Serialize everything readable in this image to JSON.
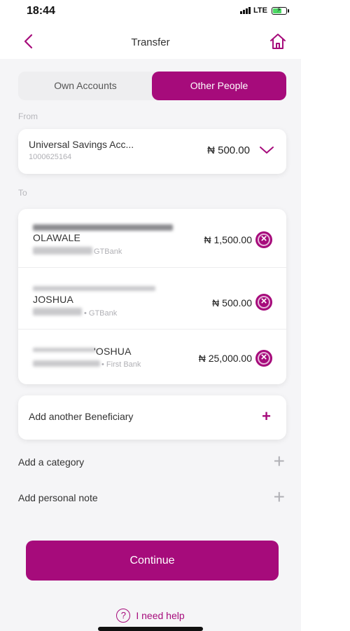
{
  "status_bar": {
    "time": "18:44",
    "network": "LTE"
  },
  "header": {
    "title": "Transfer"
  },
  "tabs": [
    {
      "label": "Own Accounts",
      "selected": false
    },
    {
      "label": "Other People",
      "selected": true
    }
  ],
  "from": {
    "label": "From",
    "account_name": "Universal Savings Acc...",
    "account_number": "1000625164",
    "balance": "₦ 500.00"
  },
  "to": {
    "label": "To",
    "beneficiaries": [
      {
        "name": "OLAWALE",
        "bank": "GTBank",
        "amount": "₦ 1,500.00"
      },
      {
        "name": "JOSHUA",
        "bank": "• GTBank",
        "amount": "₦ 500.00"
      },
      {
        "name": "'OSHUA",
        "bank": "• First Bank",
        "amount": "₦ 25,000.00"
      }
    ]
  },
  "add_beneficiary": {
    "label": "Add another Beneficiary",
    "icon": "+"
  },
  "add_category": {
    "label": "Add a category",
    "icon": "+"
  },
  "add_note": {
    "label": "Add personal note",
    "icon": "+"
  },
  "continue_button": {
    "label": "Continue"
  },
  "help": {
    "icon": "?",
    "label": "I need help"
  },
  "colors": {
    "accent": "#a60b7b",
    "background": "#f5f5f7",
    "card": "#ffffff"
  }
}
